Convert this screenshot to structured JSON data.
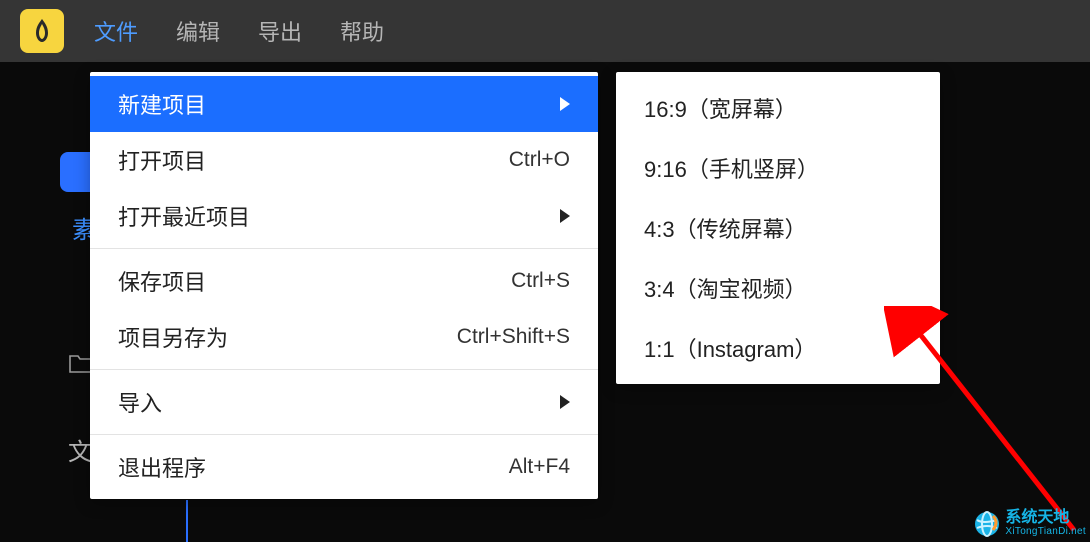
{
  "topbar": {
    "menu": {
      "file": "文件",
      "edit": "编辑",
      "export": "导出",
      "help": "帮助"
    }
  },
  "sidebar": {
    "tab_label": "素",
    "bottom_label": "文"
  },
  "file_menu": {
    "new_project": "新建项目",
    "open_project": {
      "label": "打开项目",
      "shortcut": "Ctrl+O"
    },
    "open_recent": "打开最近项目",
    "save_project": {
      "label": "保存项目",
      "shortcut": "Ctrl+S"
    },
    "save_as": {
      "label": "项目另存为",
      "shortcut": "Ctrl+Shift+S"
    },
    "import": "导入",
    "exit": {
      "label": "退出程序",
      "shortcut": "Alt+F4"
    }
  },
  "new_project_submenu": {
    "r16_9": "16:9（宽屏幕）",
    "r9_16": "9:16（手机竖屏）",
    "r4_3": "4:3（传统屏幕）",
    "r3_4": "3:4（淘宝视频）",
    "r1_1": "1:1（Instagram）"
  },
  "watermark": {
    "cn": "系统天地",
    "en": "XiTongTianDi.net"
  },
  "colors": {
    "accent": "#1b6eff",
    "logo_bg": "#f7d53f",
    "menu_active": "#4e9cff",
    "arrow": "#ff0000"
  }
}
